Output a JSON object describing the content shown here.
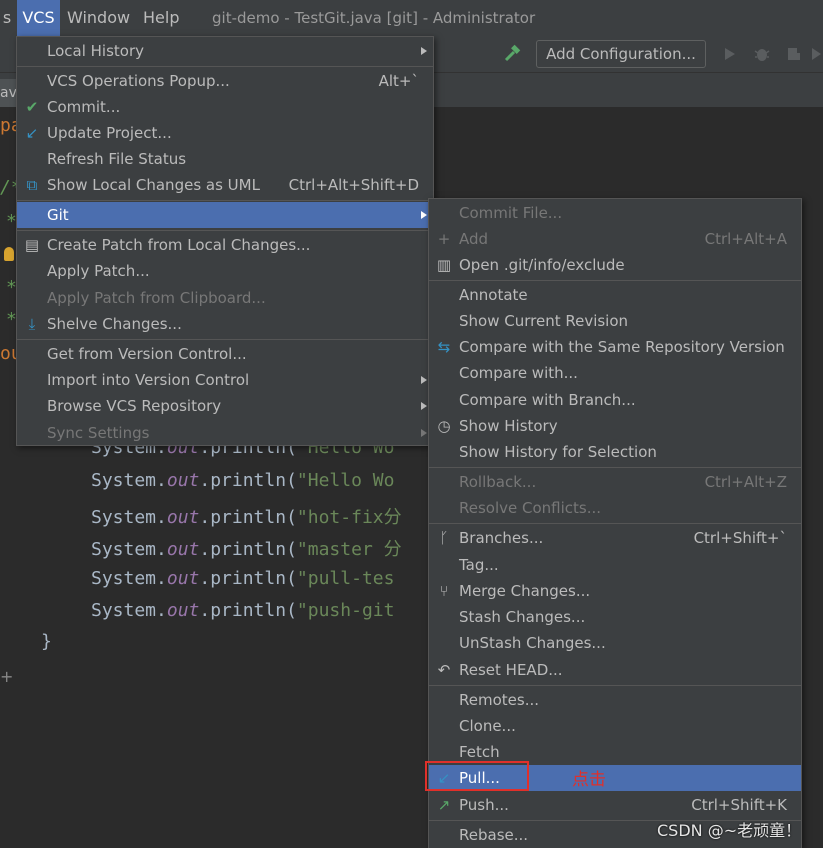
{
  "menubar": {
    "items": [
      {
        "label": "s"
      },
      {
        "label": "VCS"
      },
      {
        "label": "Window"
      },
      {
        "label": "Help"
      }
    ],
    "window_title": "git-demo - TestGit.java [git] - Administrator"
  },
  "toolbar": {
    "add_configuration": "Add Configuration..."
  },
  "editor": {
    "tab_fragment": "ava",
    "gutter_fragments": [
      "pa",
      "/*",
      "*",
      "*",
      "*",
      "ou"
    ],
    "lines": [
      {
        "pre": "System.",
        "kw": "out",
        "mid": ".println(",
        "str": "\"Hello Wo"
      },
      {
        "pre": "System.",
        "kw": "out",
        "mid": ".println(",
        "str": "\"Hello Wo"
      },
      {
        "pre": "System.",
        "kw": "out",
        "mid": ".println(",
        "str": "\"hot-fix分"
      },
      {
        "pre": "System.",
        "kw": "out",
        "mid": ".println(",
        "str": "\"master 分"
      },
      {
        "pre": "System.",
        "kw": "out",
        "mid": ".println(",
        "str": "\"pull-tes"
      },
      {
        "pre": "System.",
        "kw": "out",
        "mid": ".println(",
        "str": "\"push-git"
      }
    ],
    "closing_brace": "}"
  },
  "vcs_menu": {
    "items": [
      {
        "label": "Local History",
        "shortcut": "",
        "submenu": true
      },
      {
        "label": "VCS Operations Popup...",
        "shortcut": "Alt+`"
      },
      {
        "label": "Commit...",
        "shortcut": ""
      },
      {
        "label": "Update Project...",
        "shortcut": ""
      },
      {
        "label": "Refresh File Status",
        "shortcut": ""
      },
      {
        "label": "Show Local Changes as UML",
        "shortcut": "Ctrl+Alt+Shift+D"
      },
      {
        "label": "Git",
        "shortcut": "",
        "submenu": true
      },
      {
        "label": "Create Patch from Local Changes...",
        "shortcut": ""
      },
      {
        "label": "Apply Patch...",
        "shortcut": ""
      },
      {
        "label": "Apply Patch from Clipboard...",
        "shortcut": ""
      },
      {
        "label": "Shelve Changes...",
        "shortcut": ""
      },
      {
        "label": "Get from Version Control...",
        "shortcut": ""
      },
      {
        "label": "Import into Version Control",
        "shortcut": "",
        "submenu": true
      },
      {
        "label": "Browse VCS Repository",
        "shortcut": "",
        "submenu": true
      },
      {
        "label": "Sync Settings",
        "shortcut": "",
        "submenu": true
      }
    ]
  },
  "git_menu": {
    "items": [
      {
        "label": "Commit File...",
        "shortcut": ""
      },
      {
        "label": "Add",
        "shortcut": "Ctrl+Alt+A"
      },
      {
        "label": "Open .git/info/exclude",
        "shortcut": ""
      },
      {
        "label": "Annotate",
        "shortcut": ""
      },
      {
        "label": "Show Current Revision",
        "shortcut": ""
      },
      {
        "label": "Compare with the Same Repository Version",
        "shortcut": ""
      },
      {
        "label": "Compare with...",
        "shortcut": ""
      },
      {
        "label": "Compare with Branch...",
        "shortcut": ""
      },
      {
        "label": "Show History",
        "shortcut": ""
      },
      {
        "label": "Show History for Selection",
        "shortcut": ""
      },
      {
        "label": "Rollback...",
        "shortcut": "Ctrl+Alt+Z"
      },
      {
        "label": "Resolve Conflicts...",
        "shortcut": ""
      },
      {
        "label": "Branches...",
        "shortcut": "Ctrl+Shift+`"
      },
      {
        "label": "Tag...",
        "shortcut": ""
      },
      {
        "label": "Merge Changes...",
        "shortcut": ""
      },
      {
        "label": "Stash Changes...",
        "shortcut": ""
      },
      {
        "label": "UnStash Changes...",
        "shortcut": ""
      },
      {
        "label": "Reset HEAD...",
        "shortcut": ""
      },
      {
        "label": "Remotes...",
        "shortcut": ""
      },
      {
        "label": "Clone...",
        "shortcut": ""
      },
      {
        "label": "Fetch",
        "shortcut": ""
      },
      {
        "label": "Pull...",
        "shortcut": ""
      },
      {
        "label": "Push...",
        "shortcut": "Ctrl+Shift+K"
      },
      {
        "label": "Rebase...",
        "shortcut": ""
      }
    ]
  },
  "annotation": {
    "text": "点击",
    "color": "#e0302a"
  },
  "watermark": "CSDN @~老顽童！",
  "colors": {
    "highlight": "#4b6eaf",
    "menu_bg": "#3c3f41",
    "editor_bg": "#2b2b2b",
    "annotation_box": "#e0302a"
  }
}
